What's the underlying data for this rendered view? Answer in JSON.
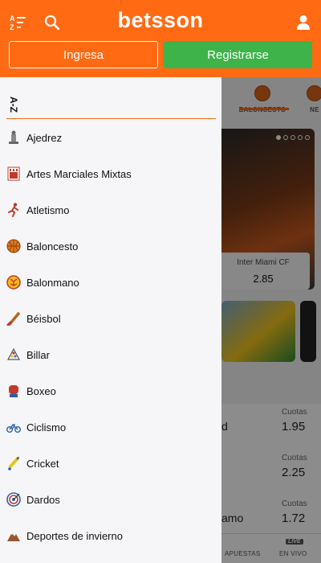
{
  "header": {
    "logo": "betsson",
    "login_label": "Ingresa",
    "register_label": "Registrarse",
    "icons": [
      "az-sort-icon",
      "search-icon",
      "user-icon"
    ]
  },
  "drawer": {
    "sort_label": "A-Z",
    "sports": [
      {
        "label": "Ajedrez",
        "icon": "chess-icon"
      },
      {
        "label": "Artes Marciales Mixtas",
        "icon": "mma-icon"
      },
      {
        "label": "Atletismo",
        "icon": "running-icon"
      },
      {
        "label": "Baloncesto",
        "icon": "basketball-icon"
      },
      {
        "label": "Balonmano",
        "icon": "handball-icon"
      },
      {
        "label": "Béisbol",
        "icon": "baseball-icon"
      },
      {
        "label": "Billar",
        "icon": "billiards-icon"
      },
      {
        "label": "Boxeo",
        "icon": "boxing-glove-icon"
      },
      {
        "label": "Ciclismo",
        "icon": "bicycle-icon"
      },
      {
        "label": "Cricket",
        "icon": "cricket-icon"
      },
      {
        "label": "Dardos",
        "icon": "dartboard-icon"
      },
      {
        "label": "Deportes de invierno",
        "icon": "mountain-icon"
      }
    ]
  },
  "background": {
    "sport_tabs": [
      "BALONCESTO",
      "NE"
    ],
    "banner_match": {
      "team": "Inter Miami CF",
      "odd": "2.85"
    },
    "odds_rows": [
      {
        "team": "d",
        "label": "Cuotas",
        "value": "1.95"
      },
      {
        "team": "",
        "label": "Cuotas",
        "value": "2.25"
      },
      {
        "team": "amo",
        "label": "Cuotas",
        "value": "1.72"
      }
    ],
    "bottom_nav": {
      "bets": "APUESTAS",
      "live": "EN VIVO",
      "live_badge": "LIVE"
    }
  },
  "colors": {
    "brand": "#ff6a13",
    "register": "#3db34a"
  }
}
